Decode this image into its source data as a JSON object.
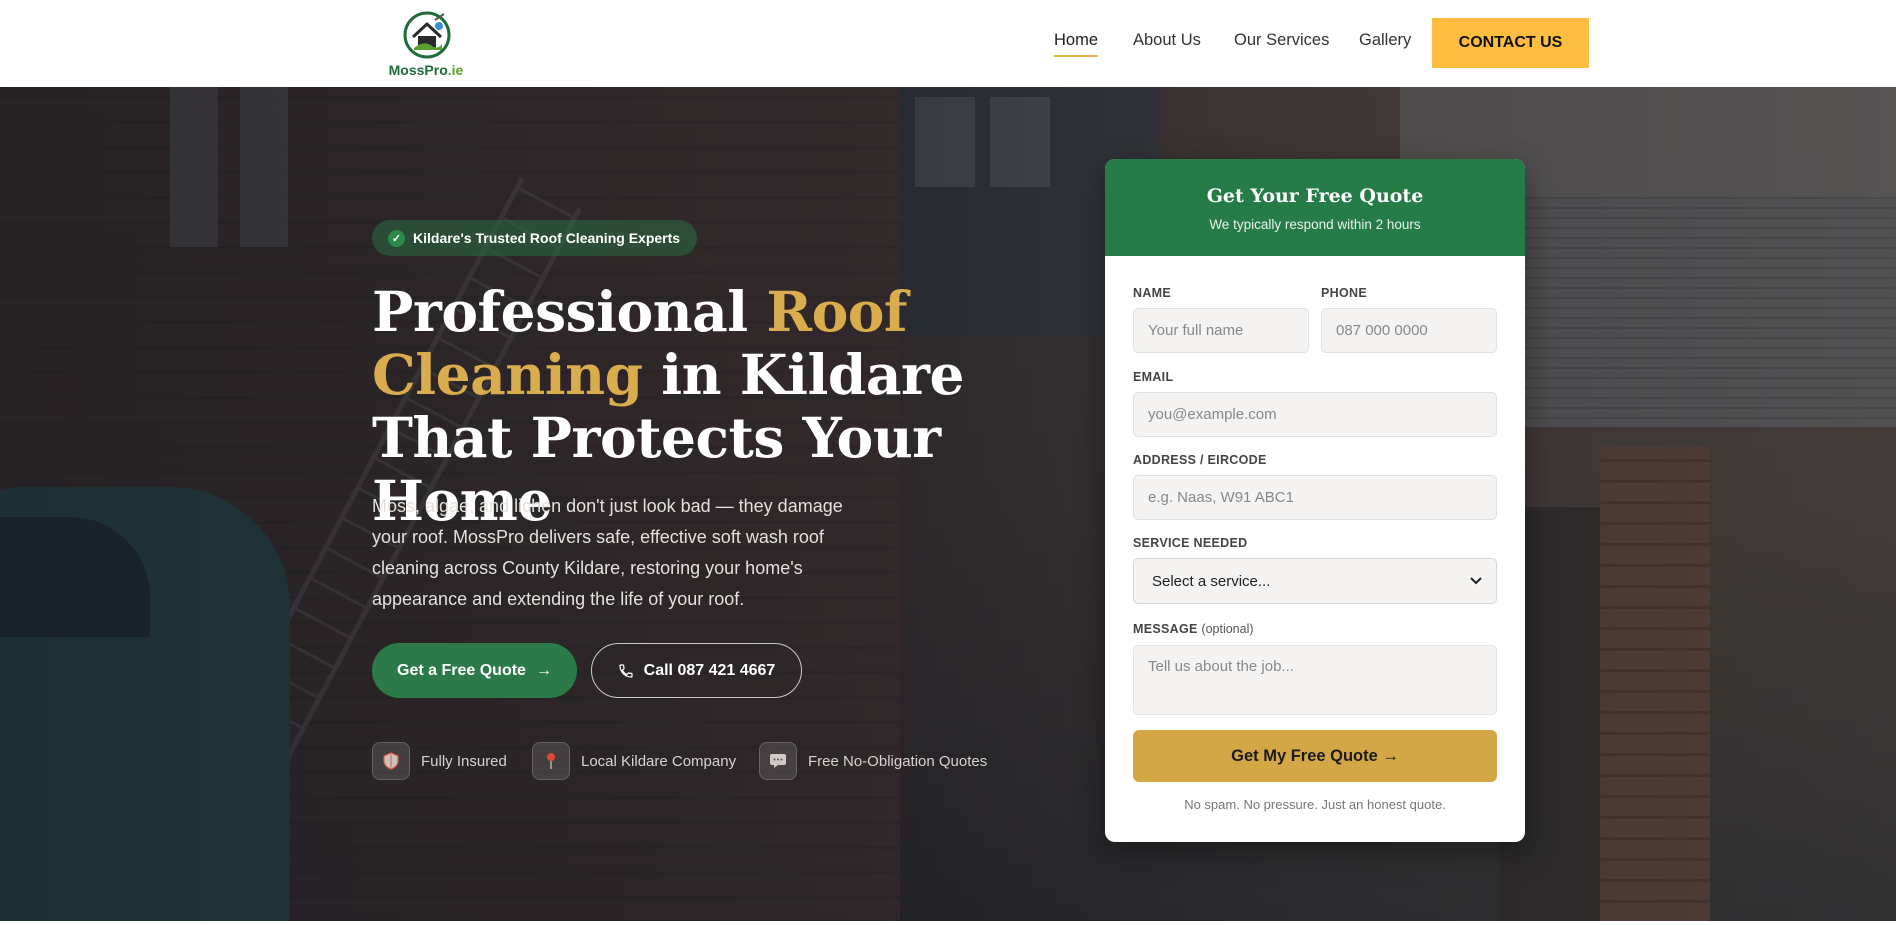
{
  "brand": {
    "name_main": "MossPro",
    "name_tld": ".ie",
    "green": "#1f6b3a",
    "accent_gold": "#d9ac4e",
    "cta_yellow": "#fdbd41"
  },
  "nav": {
    "items": [
      {
        "label": "Home",
        "active": true
      },
      {
        "label": "About Us",
        "active": false
      },
      {
        "label": "Our Services",
        "active": false
      },
      {
        "label": "Gallery",
        "active": false
      }
    ],
    "contact_label": "CONTACT US"
  },
  "hero": {
    "badge": "Kildare's Trusted Roof Cleaning Experts",
    "headline": {
      "part1": "Professional ",
      "highlight": "Roof Cleaning",
      "part2": " in Kildare That Protects Your Home"
    },
    "lead": "Moss, algae, and lichen don't just look bad — they damage your roof. MossPro delivers safe, effective soft wash roof cleaning across County Kildare, restoring your home's appearance and extending the life of your roof.",
    "cta_primary": "Get a Free Quote",
    "cta_secondary": "Call 087 421 4667",
    "trust": [
      {
        "icon": "shield-icon",
        "label": "Fully Insured"
      },
      {
        "icon": "map-pin-icon",
        "label": "Local Kildare Company"
      },
      {
        "icon": "chat-bubble-icon",
        "label": "Free No-Obligation Quotes"
      }
    ]
  },
  "quote_form": {
    "title": "Get Your Free Quote",
    "subtitle": "We typically respond within 2 hours",
    "name_label": "NAME",
    "name_placeholder": "Your full name",
    "phone_label": "PHONE",
    "phone_placeholder": "087 000 0000",
    "email_label": "EMAIL",
    "email_placeholder": "you@example.com",
    "address_label": "ADDRESS / EIRCODE",
    "address_placeholder": "e.g. Naas, W91 ABC1",
    "service_label": "SERVICE NEEDED",
    "service_selected": "Select a service...",
    "message_label": "MESSAGE",
    "message_optional": "(optional)",
    "message_placeholder": "Tell us about the job...",
    "submit_label": "Get My Free Quote →",
    "fine_print": "No spam. No pressure. Just an honest quote."
  }
}
